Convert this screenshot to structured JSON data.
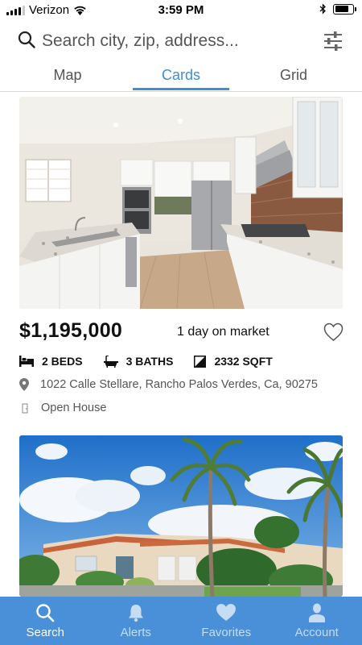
{
  "status_bar": {
    "carrier": "Verizon",
    "time": "3:59 PM",
    "battery_level": 0.85
  },
  "search": {
    "placeholder": "Search city, zip, address..."
  },
  "icons": {
    "search": "search-icon",
    "filter": "sliders-icon",
    "bed": "bed-icon",
    "bath": "bathtub-icon",
    "sqft": "square-footage-icon",
    "location": "map-pin-icon",
    "open_house": "door-icon",
    "favorite": "heart-outline-icon"
  },
  "tabs": [
    {
      "label": "Map",
      "active": false
    },
    {
      "label": "Cards",
      "active": true
    },
    {
      "label": "Grid",
      "active": false
    }
  ],
  "listings": [
    {
      "price": "$1,195,000",
      "days_on_market": "1 day on market",
      "beds": "2 BEDS",
      "baths": "3 BATHS",
      "sqft": "2332 SQFT",
      "address": "1022 Calle Stellare, Rancho Palos Verdes, Ca, 90275",
      "open_house": "Open House",
      "photo": "kitchen"
    },
    {
      "photo": "palm-house-exterior"
    }
  ],
  "bottom_nav": [
    {
      "label": "Search",
      "icon": "search-icon",
      "active": true
    },
    {
      "label": "Alerts",
      "icon": "bell-icon",
      "active": false
    },
    {
      "label": "Favorites",
      "icon": "heart-icon",
      "active": false
    },
    {
      "label": "Account",
      "icon": "person-icon",
      "active": false
    }
  ],
  "colors": {
    "accent": "#3a8fdc",
    "nav_bg": "#4a90d9",
    "nav_inactive": "#c6dcf3"
  }
}
